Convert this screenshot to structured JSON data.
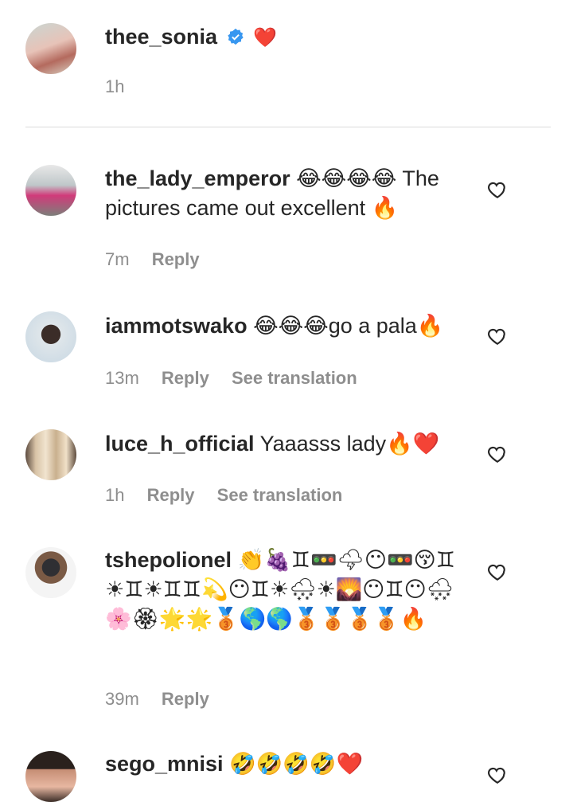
{
  "caption": {
    "username": "thee_sonia",
    "text": "❤️",
    "time": "1h"
  },
  "comments": [
    {
      "username": "the_lady_emperor",
      "text": "😂😂😂😂 The pictures came out excellent 🔥",
      "time": "7m",
      "reply": "Reply"
    },
    {
      "username": "iammotswako",
      "text": "😂😂😂go a pala🔥",
      "time": "13m",
      "reply": "Reply",
      "translate": "See translation"
    },
    {
      "username": "luce_h_official",
      "text": "Yaaasss lady🔥❤️",
      "time": "1h",
      "reply": "Reply",
      "translate": "See translation"
    },
    {
      "username": "tshepolionel",
      "text": "👏🍇♊🚥🌩😶🚥😚♊☀♊☀♊♊💫😶♊☀🌨☀🌄😶♊😶🌨🌸🏵🌟🌟🥉🌎🌎🥉🥉🥉🥉🔥",
      "time": "39m",
      "reply": "Reply"
    },
    {
      "username": "sego_mnisi",
      "text": "🤣🤣🤣🤣❤️"
    }
  ],
  "colors": {
    "text": "#262626",
    "meta": "#8e8e8e",
    "verified": "#3897f0",
    "heart_red": "#ed4956"
  }
}
